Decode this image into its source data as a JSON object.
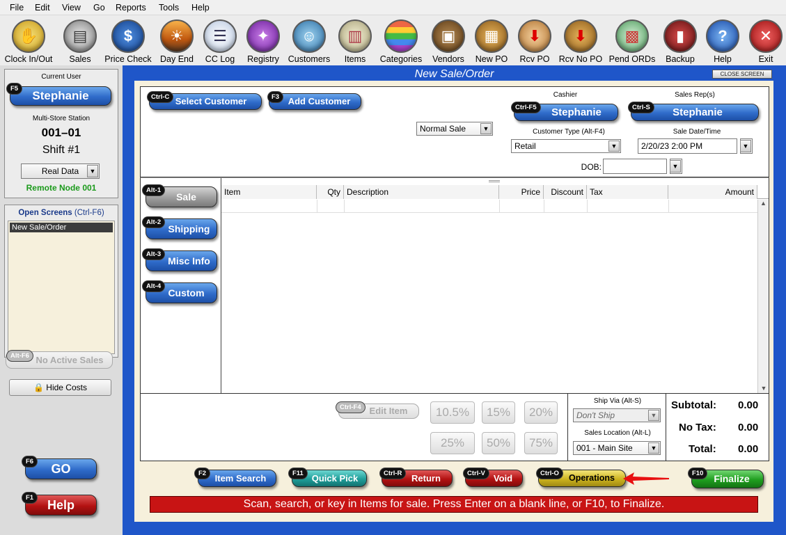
{
  "menu": [
    "File",
    "Edit",
    "View",
    "Go",
    "Reports",
    "Tools",
    "Help"
  ],
  "toolbar": {
    "clock": "Clock In/Out",
    "sales": "Sales",
    "price": "Price Check",
    "dayend": "Day End",
    "cclog": "CC Log",
    "registry": "Registry",
    "customers": "Customers",
    "items": "Items",
    "categories": "Categories",
    "vendors": "Vendors",
    "newpo": "New PO",
    "rcvpo": "Rcv PO",
    "rcvnopo": "Rcv No PO",
    "pendords": "Pend ORDs",
    "backup": "Backup",
    "help": "Help",
    "exit": "Exit"
  },
  "left": {
    "current_user_label": "Current User",
    "user_key": "F5",
    "user": "Stephanie",
    "station_label": "Multi-Store Station",
    "station": "001–01",
    "shift": "Shift #1",
    "data_mode": "Real Data",
    "node": "Remote Node 001",
    "open_screens_label": "Open Screens",
    "open_screens_key": "(Ctrl-F6)",
    "open_screen_item": "New Sale/Order",
    "no_active_key": "Alt-F6",
    "no_active": "No Active Sales",
    "hide_costs": "Hide Costs",
    "go_key": "F6",
    "go": "GO",
    "help_key": "F1",
    "help": "Help"
  },
  "window": {
    "title": "New Sale/Order",
    "close": "CLOSE SCREEN"
  },
  "header": {
    "select_key": "Ctrl-C",
    "select_customer": "Select Customer",
    "add_key": "F3",
    "add_customer": "Add Customer",
    "sale_type": "Normal Sale",
    "cashier_label": "Cashier",
    "cashier_key": "Ctrl-F5",
    "cashier": "Stephanie",
    "rep_label": "Sales Rep(s)",
    "rep_key": "Ctrl-S",
    "rep": "Stephanie",
    "ctype_label": "Customer Type (Alt-F4)",
    "ctype": "Retail",
    "date_label": "Sale Date/Time",
    "date": "2/20/23 2:00 PM",
    "dob_label": "DOB:",
    "dob": ""
  },
  "tabs": [
    {
      "key": "Alt-1",
      "label": "Sale"
    },
    {
      "key": "Alt-2",
      "label": "Shipping"
    },
    {
      "key": "Alt-3",
      "label": "Misc Info"
    },
    {
      "key": "Alt-4",
      "label": "Custom"
    }
  ],
  "columns": [
    "Item",
    "Qty",
    "Description",
    "Price",
    "Discount",
    "Tax",
    "Amount"
  ],
  "bottom": {
    "edit_key": "Ctrl-F4",
    "edit": "Edit Item",
    "discounts": [
      "10.5%",
      "15%",
      "20%",
      "25%",
      "50%",
      "75%"
    ],
    "ship_label": "Ship Via (Alt-S)",
    "ship": "Don't Ship",
    "loc_label": "Sales Location (Alt-L)",
    "loc": "001 - Main Site",
    "subtotal_label": "Subtotal:",
    "subtotal": "0.00",
    "tax_label": "No Tax:",
    "tax": "0.00",
    "total_label": "Total:",
    "total": "0.00"
  },
  "actions": [
    {
      "key": "F2",
      "label": "Item Search"
    },
    {
      "key": "F11",
      "label": "Quick Pick"
    },
    {
      "key": "Ctrl-R",
      "label": "Return"
    },
    {
      "key": "Ctrl-V",
      "label": "Void"
    },
    {
      "key": "Ctrl-O",
      "label": "Operations"
    },
    {
      "key": "F10",
      "label": "Finalize"
    }
  ],
  "status": "Scan, search, or key in Items for sale. Press Enter on a blank line, or F10, to Finalize.",
  "colors": {
    "accent_blue": "#1f56c9",
    "status_red": "#c81414",
    "form_bg": "#f6f0dc",
    "node_green": "#1b9a1b"
  }
}
